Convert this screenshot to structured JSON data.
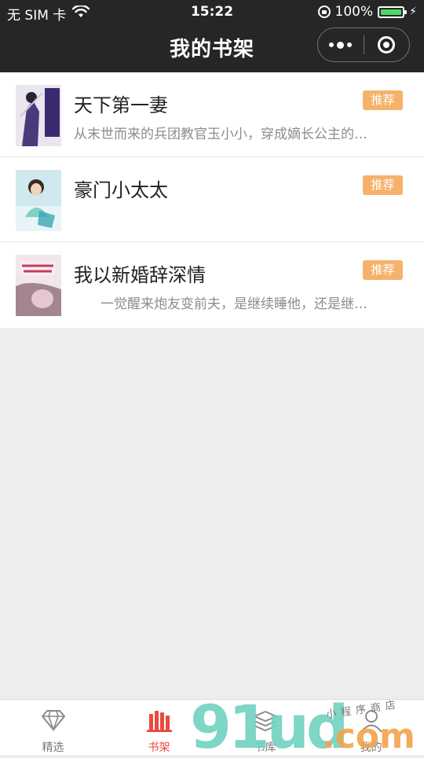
{
  "status_bar": {
    "carrier": "无 SIM 卡",
    "time": "15:22",
    "battery_percent": "100%",
    "battery_level": 1.0
  },
  "header": {
    "title": "我的书架"
  },
  "books": [
    {
      "title": "天下第一妻",
      "badge": "推荐",
      "description": "从末世而来的兵团教官玉小小，穿成嫡长公主的…",
      "cover_text": "天下第一妻"
    },
    {
      "title": "豪门小太太",
      "badge": "推荐",
      "description": "",
      "cover_text": "豪门小太太"
    },
    {
      "title": "我以新婚辞深情",
      "badge": "推荐",
      "description": "　　一觉醒来炮友变前夫，是继续睡他，还是继…",
      "cover_text": "我以新婚辞深情"
    }
  ],
  "tabbar": {
    "tabs": [
      {
        "label": "精选",
        "icon": "diamond-icon",
        "active": false
      },
      {
        "label": "书架",
        "icon": "bookshelf-icon",
        "active": true
      },
      {
        "label": "书库",
        "icon": "layers-icon",
        "active": false
      },
      {
        "label": "我的",
        "icon": "person-icon",
        "active": false
      }
    ]
  },
  "watermark": {
    "text": "91ud.com",
    "tagline": "小程序商店"
  },
  "colors": {
    "header_bg": "#262626",
    "badge_bg": "#f6b26b",
    "active_tab": "#e84a3f",
    "page_bg": "#ededed"
  }
}
